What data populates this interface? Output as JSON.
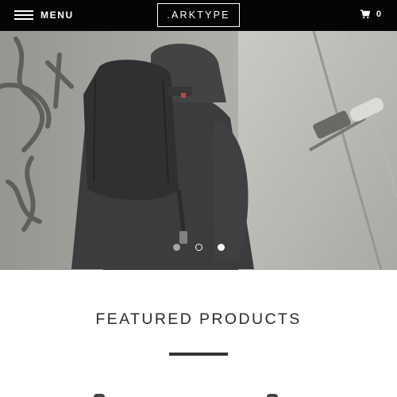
{
  "header": {
    "menu_label": "MENU",
    "logo_text": ".ARKTYPE",
    "cart_count": "0",
    "menu_icon": "hamburger-icon",
    "cart_icon": "shopping-cart-icon",
    "background": "#050505"
  },
  "hero": {
    "slides_total": 3,
    "active_slide": 2
  },
  "featured": {
    "title": "FEATURED PRODUCTS"
  }
}
